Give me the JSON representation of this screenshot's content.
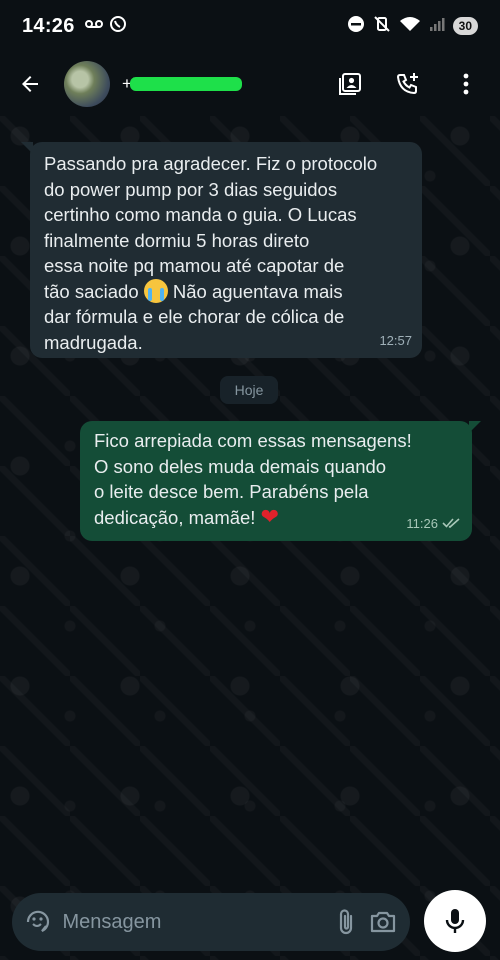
{
  "status_bar": {
    "time": "14:26",
    "battery": "30"
  },
  "header": {
    "contact_name": "+5"
  },
  "messages": {
    "incoming_text": "Passando pra agradecer. Fiz o protocolo\ndo power pump por 3 dias seguidos\ncertinho como manda o guia. O Lucas\nfinalmente dormiu 5 horas direto\nessa noite pq mamou até capotar de\ntão saciado",
    "incoming_text_2": " Não aguentava mais\ndar fórmula e ele chorar de cólica de\nmadrugada.",
    "incoming_time": "12:57",
    "date_divider": "Hoje",
    "outgoing_text": "Fico arrepiada com essas mensagens!\nO sono deles muda demais quando\no leite desce bem. Parabéns pela\ndedicação, mamãe! ",
    "outgoing_emoji": "❤",
    "outgoing_time": "11:26"
  },
  "input": {
    "placeholder": "Mensagem"
  },
  "colors": {
    "incoming_bubble": "#202c33",
    "outgoing_bubble": "#144d37",
    "background": "#0b1014",
    "mic_button": "#ffffff"
  },
  "icons": [
    "back-arrow-icon",
    "contact-card-icon",
    "add-call-icon",
    "more-vert-icon",
    "sticker-icon",
    "attach-icon",
    "camera-icon",
    "mic-icon",
    "double-check-icon"
  ]
}
